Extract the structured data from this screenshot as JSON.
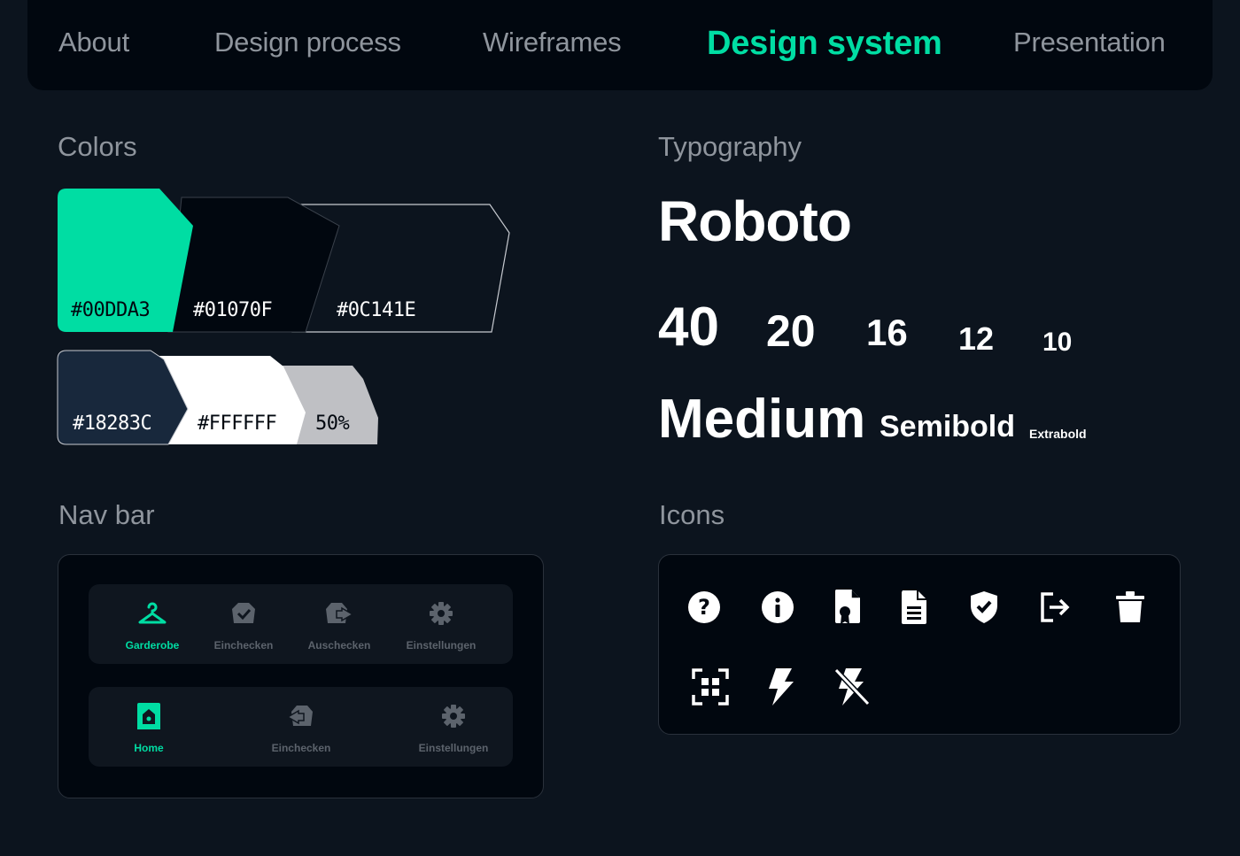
{
  "topnav": {
    "tabs": [
      {
        "label": "About"
      },
      {
        "label": "Design process"
      },
      {
        "label": "Wireframes"
      },
      {
        "label": "Design system"
      },
      {
        "label": "Presentation"
      }
    ],
    "active_tab": "Design system"
  },
  "colors": {
    "title": "Colors",
    "swatches": [
      {
        "hex": "#00DDA3",
        "label": "#00DDA3"
      },
      {
        "hex": "#01070F",
        "label": "#01070F"
      },
      {
        "hex": "#0C141E",
        "label": "#0C141E"
      },
      {
        "hex": "#18283C",
        "label": "#18283C"
      },
      {
        "hex": "#FFFFFF",
        "label": "#FFFFFF"
      },
      {
        "hex": "#BFC0C4",
        "label": "50%"
      }
    ]
  },
  "typography": {
    "title": "Typography",
    "font_name": "Roboto",
    "sizes": [
      "40",
      "20",
      "16",
      "12",
      "10"
    ],
    "weights": [
      "Medium",
      "Semibold",
      "Extrabold"
    ]
  },
  "navbar_section": {
    "title": "Nav bar",
    "bar1": [
      {
        "label": "Garderobe",
        "icon": "hanger-icon",
        "active": true
      },
      {
        "label": "Einchecken",
        "icon": "check-in-icon",
        "active": false
      },
      {
        "label": "Auschecken",
        "icon": "check-out-icon",
        "active": false
      },
      {
        "label": "Einstellungen",
        "icon": "gear-icon",
        "active": false
      }
    ],
    "bar2": [
      {
        "label": "Home",
        "icon": "home-icon",
        "active": true
      },
      {
        "label": "Einchecken",
        "icon": "check-in-icon",
        "active": false
      },
      {
        "label": "Einstellungen",
        "icon": "gear-icon",
        "active": false
      }
    ]
  },
  "icons_section": {
    "title": "Icons",
    "icons": [
      "question-icon",
      "info-icon",
      "certificate-file-icon",
      "document-icon",
      "shield-check-icon",
      "logout-icon",
      "trash-icon",
      "qr-scan-icon",
      "flash-icon",
      "flash-off-icon"
    ]
  },
  "theme": {
    "accent": "#00DDA3",
    "muted_text": "#8F959D",
    "inactive_icon": "#5C636C",
    "panel_bg": "#01070F",
    "page_bg": "#0C141E"
  }
}
